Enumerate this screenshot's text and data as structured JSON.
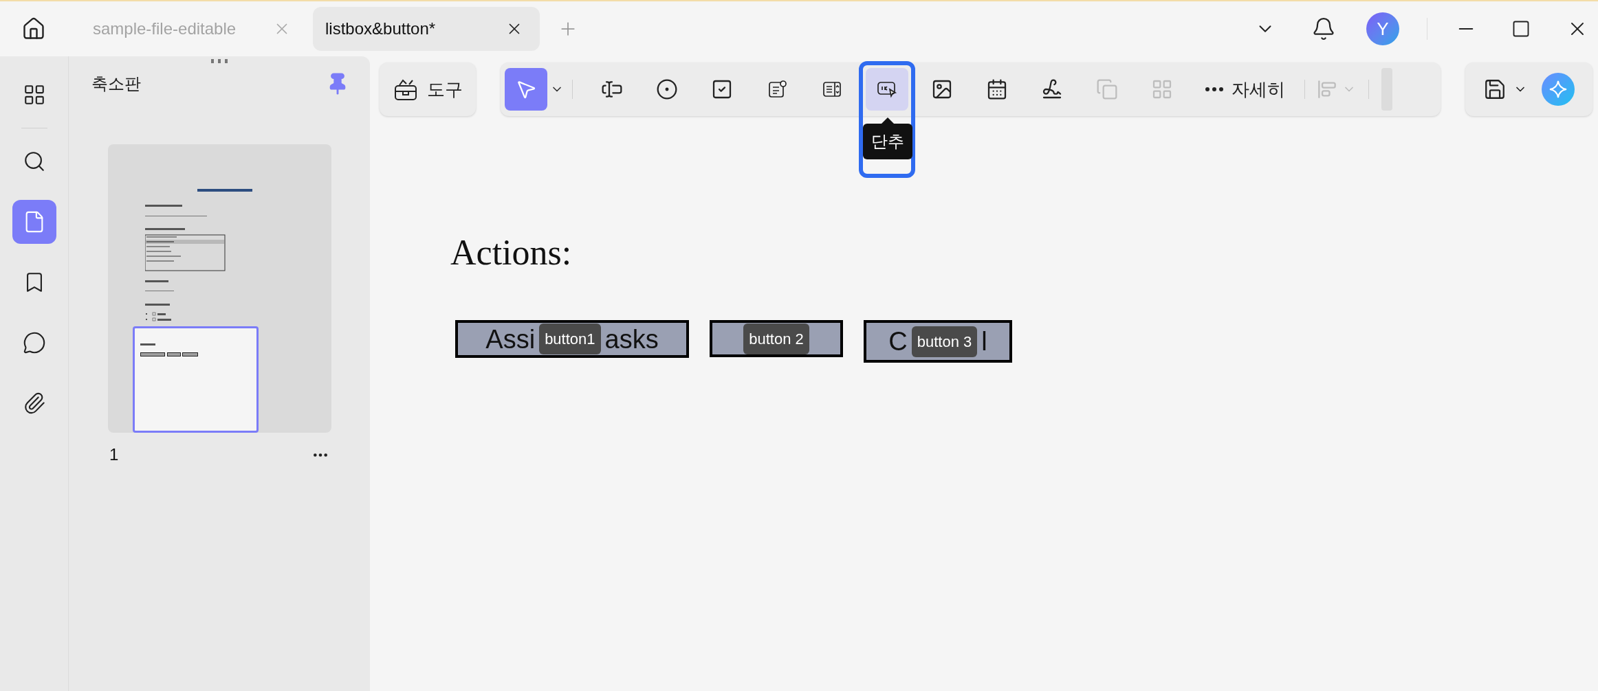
{
  "tabs": [
    {
      "label": "sample-file-editable",
      "selected": false
    },
    {
      "label": "listbox&button*",
      "selected": true
    }
  ],
  "avatar": {
    "initial": "Y"
  },
  "sidebar": {
    "items": [
      {
        "kind": "grid",
        "selected": false
      },
      {
        "kind": "search",
        "selected": false
      },
      {
        "kind": "page",
        "selected": true
      },
      {
        "kind": "bookmark",
        "selected": false
      },
      {
        "kind": "comment",
        "selected": false
      },
      {
        "kind": "attachment",
        "selected": false
      }
    ]
  },
  "thumbnails": {
    "title": "축소판",
    "pages": [
      {
        "number": "1",
        "selected": true
      }
    ]
  },
  "tools_button": {
    "label": "도구"
  },
  "toolbar": {
    "tools": [
      {
        "kind": "select",
        "selected": true,
        "disabled": false
      },
      {
        "kind": "text-field",
        "selected": false,
        "disabled": false
      },
      {
        "kind": "radio",
        "selected": false,
        "disabled": false
      },
      {
        "kind": "checkbox",
        "selected": false,
        "disabled": false
      },
      {
        "kind": "combo-box",
        "selected": false,
        "disabled": false
      },
      {
        "kind": "list-box",
        "selected": false,
        "disabled": false
      },
      {
        "kind": "push-button",
        "selected": false,
        "disabled": false,
        "tooltip": "단추"
      },
      {
        "kind": "image",
        "selected": false,
        "disabled": false
      },
      {
        "kind": "date",
        "selected": false,
        "disabled": false
      },
      {
        "kind": "signature",
        "selected": false,
        "disabled": false
      },
      {
        "kind": "duplicate",
        "selected": false,
        "disabled": true
      },
      {
        "kind": "arrange",
        "selected": false,
        "disabled": true
      }
    ],
    "more": {
      "label": "자세히"
    },
    "align_disabled": true
  },
  "canvas": {
    "heading": "Actions:",
    "buttons": [
      {
        "caption_parts": [
          "Assi",
          "asks"
        ],
        "field_name": "button1"
      },
      {
        "field_name": "button 2"
      },
      {
        "caption_parts": [
          "C",
          "l"
        ],
        "field_name": "button 3"
      }
    ]
  }
}
